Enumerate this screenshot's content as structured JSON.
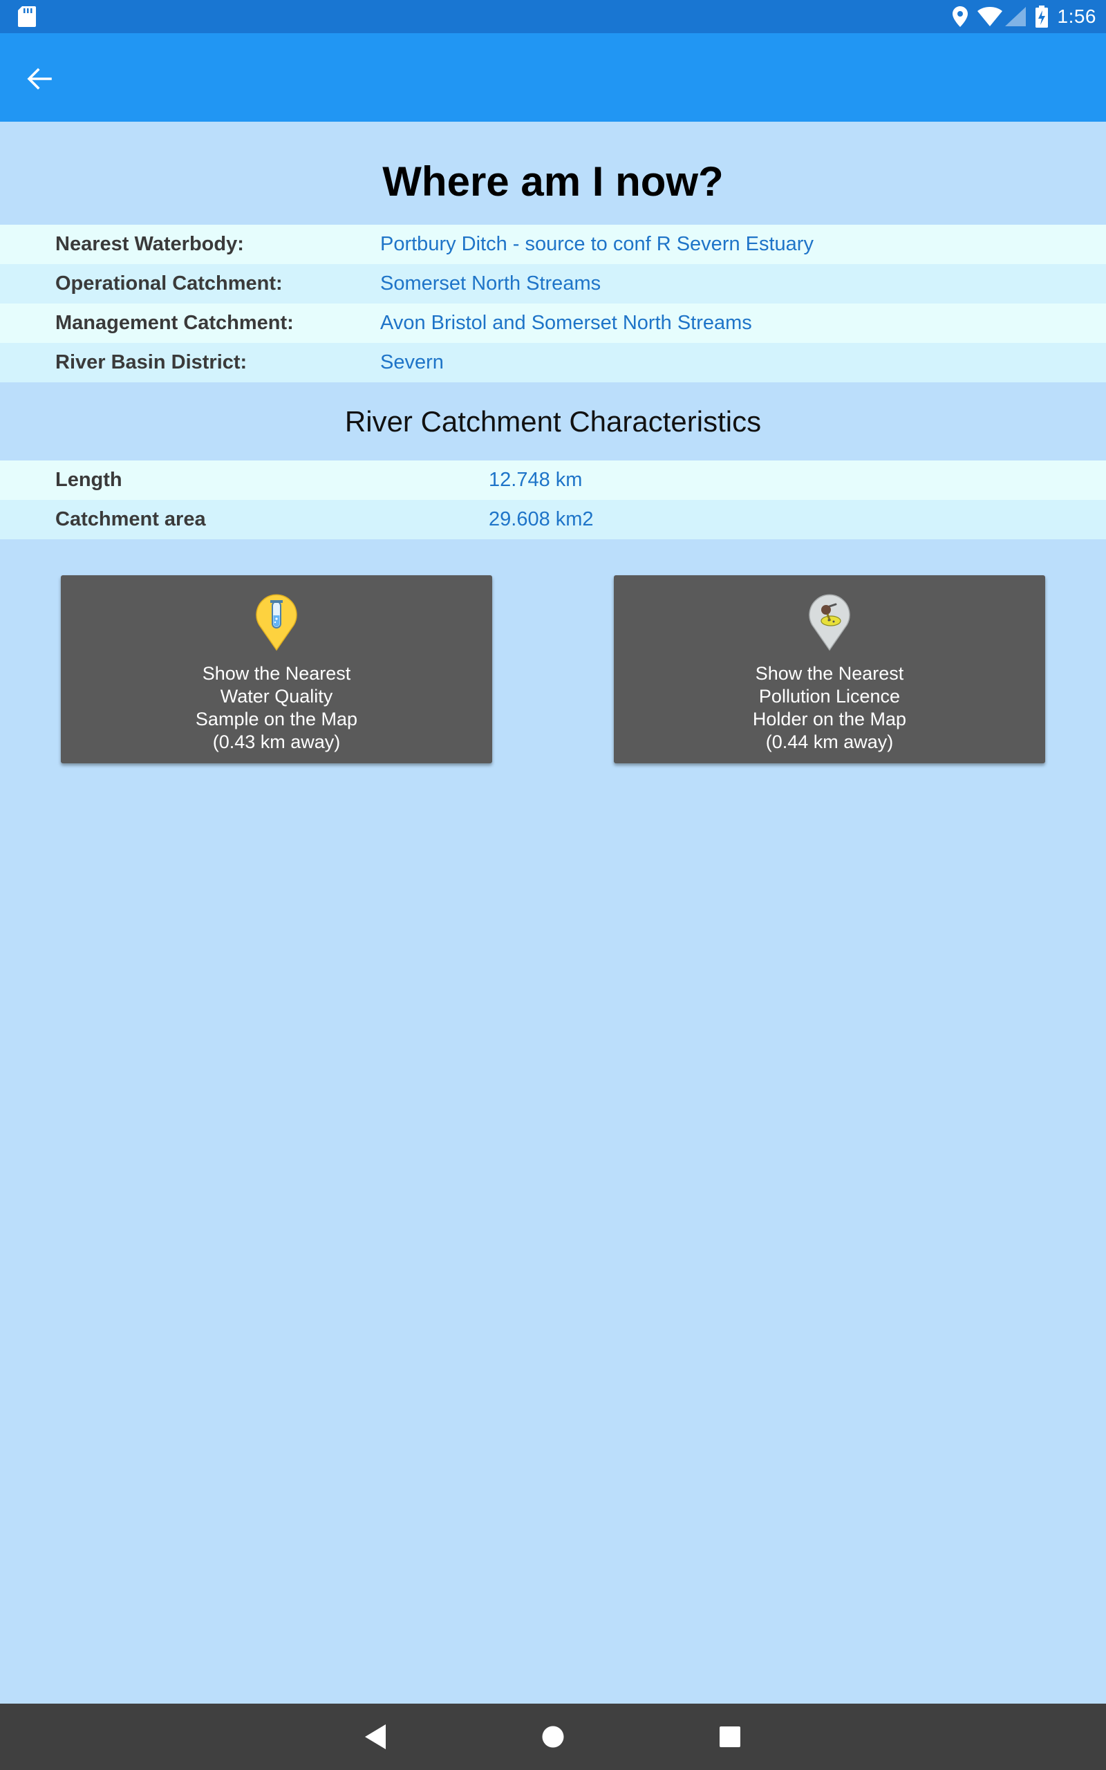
{
  "status_bar": {
    "time": "1:56",
    "icons": [
      "sd-card-icon",
      "location-icon",
      "wifi-icon",
      "signal-icon",
      "battery-charging-icon"
    ]
  },
  "app_bar": {
    "back_icon": "arrow-left-icon"
  },
  "page": {
    "title": "Where am I now?",
    "location_rows": [
      {
        "label": "Nearest Waterbody:",
        "value": "Portbury Ditch - source to conf R Severn Estuary"
      },
      {
        "label": "Operational Catchment:",
        "value": "Somerset North Streams"
      },
      {
        "label": "Management Catchment:",
        "value": "Avon Bristol and Somerset North Streams"
      },
      {
        "label": "River Basin District:",
        "value": "Severn"
      }
    ],
    "section_title": "River Catchment Characteristics",
    "characteristics": [
      {
        "label": "Length",
        "value": "12.748 km"
      },
      {
        "label": "Catchment area",
        "value": "29.608 km2"
      }
    ]
  },
  "buttons": {
    "water_quality": {
      "icon": "water-quality-sample-pin-icon",
      "lines": [
        "Show the Nearest",
        "Water Quality",
        "Sample on the Map",
        "(0.43 km away)"
      ]
    },
    "pollution_licence": {
      "icon": "pollution-licence-pin-icon",
      "lines": [
        "Show the Nearest",
        "Pollution Licence",
        "Holder on the Map",
        "(0.44 km away)"
      ]
    }
  },
  "nav_bar": {
    "icons": [
      "nav-back-icon",
      "nav-home-icon",
      "nav-recents-icon"
    ]
  },
  "colors": {
    "status_bar": "#1976D2",
    "app_bar": "#2196F3",
    "background": "#BBDEFB",
    "value_text": "#1E74C8",
    "button_bg": "#5a5a5a",
    "nav_bar": "#404040"
  }
}
